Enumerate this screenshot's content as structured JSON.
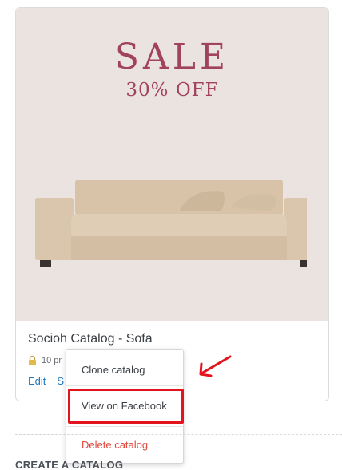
{
  "banner": {
    "headline": "SALE",
    "subheadline": "30% OFF"
  },
  "catalog": {
    "title": "Socioh Catalog - Sofa",
    "products_text": "10 pr",
    "actions": {
      "edit": "Edit",
      "second": "S",
      "more": "..."
    }
  },
  "menu": {
    "clone": "Clone catalog",
    "view_facebook": "View on Facebook",
    "delete": "Delete catalog"
  },
  "section": {
    "create_catalog": "CREATE A CATALOG"
  },
  "colors": {
    "accent_link": "#1f7ac5",
    "danger": "#e0483f",
    "highlight_box": "#e4141e",
    "banner_bg": "#ebe3df",
    "sale_text": "#a1425e"
  }
}
